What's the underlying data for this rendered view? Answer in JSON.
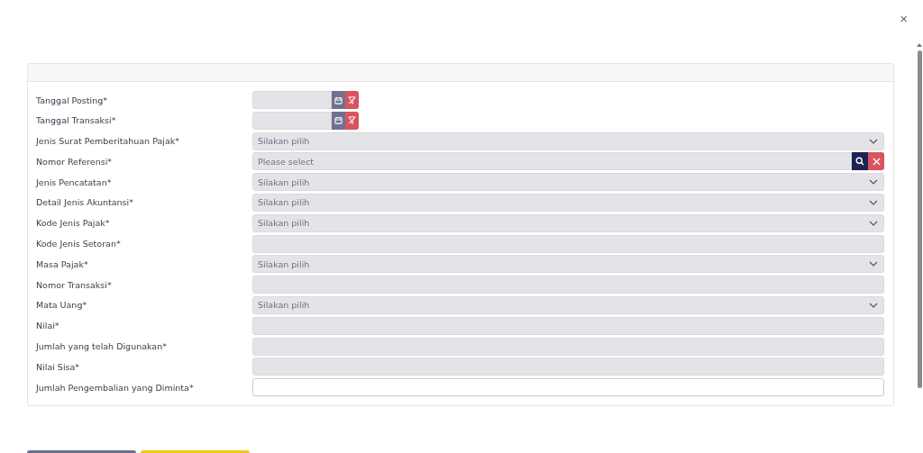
{
  "close_button": "×",
  "fields": [
    {
      "label": "Tanggal Posting*",
      "kind": "date"
    },
    {
      "label": "Tanggal Transaksi*",
      "kind": "date"
    },
    {
      "label": "Jenis Surat Pemberitahuan Pajak*",
      "kind": "select",
      "placeholder": "Silakan pilih"
    },
    {
      "label": "Nomor Referensi*",
      "kind": "lookup",
      "placeholder": "Please select"
    },
    {
      "label": "Jenis Pencatatan*",
      "kind": "select",
      "placeholder": "Silakan pilih"
    },
    {
      "label": "Detail Jenis Akuntansi*",
      "kind": "select",
      "placeholder": "Silakan pilih"
    },
    {
      "label": "Kode Jenis Pajak*",
      "kind": "select",
      "placeholder": "Silakan pilih"
    },
    {
      "label": "Kode Jenis Setoran*",
      "kind": "text",
      "disabled": true
    },
    {
      "label": "Masa Pajak*",
      "kind": "select",
      "placeholder": "Silakan pilih"
    },
    {
      "label": "Nomor Transaksi*",
      "kind": "text",
      "disabled": true
    },
    {
      "label": "Mata Uang*",
      "kind": "select",
      "placeholder": "Silakan pilih"
    },
    {
      "label": "Nilai*",
      "kind": "text",
      "disabled": true
    },
    {
      "label": "Jumlah yang telah Digunakan*",
      "kind": "text",
      "disabled": true
    },
    {
      "label": "Nilai Sisa*",
      "kind": "text",
      "disabled": true
    },
    {
      "label": "Jumlah Pengembalian yang Diminta*",
      "kind": "text",
      "disabled": false
    }
  ],
  "buttons": [
    {
      "color": "#6b6e8c"
    },
    {
      "color": "#f3c614"
    }
  ]
}
